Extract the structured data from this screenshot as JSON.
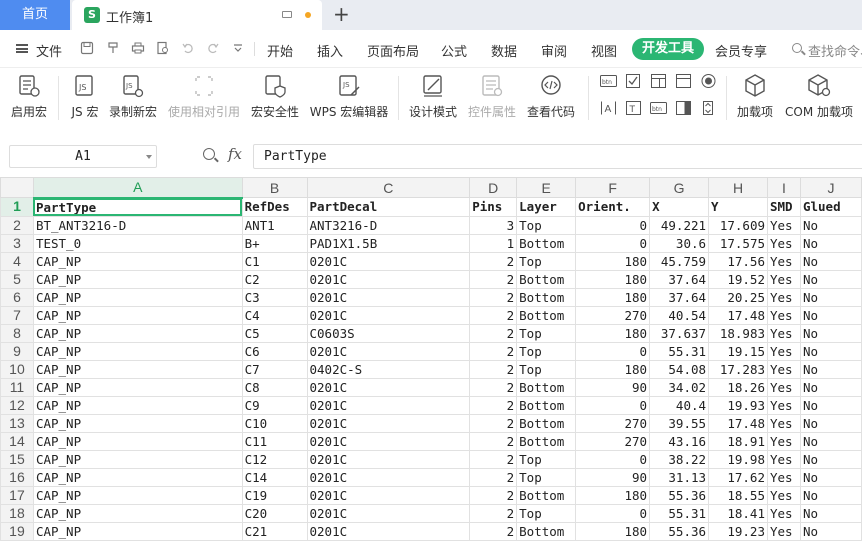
{
  "titlebar": {
    "home_label": "首页",
    "doc_name": "工作簿1",
    "doc_icon_letter": "S",
    "new_tab": "+"
  },
  "menu": {
    "file_label": "文件",
    "tabs": [
      "开始",
      "插入",
      "页面布局",
      "公式",
      "数据",
      "审阅",
      "视图",
      "开发工具",
      "会员专享"
    ],
    "active_tab": "开发工具",
    "search_placeholder": "查找命令、"
  },
  "ribbon": {
    "buttons": [
      {
        "label": "启用宏",
        "icon": "macro-enable-icon"
      },
      {
        "label": "JS 宏",
        "icon": "js-macro-icon"
      },
      {
        "label": "录制新宏",
        "icon": "record-macro-icon"
      },
      {
        "label": "使用相对引用",
        "icon": "relative-reference-icon"
      },
      {
        "label": "宏安全性",
        "icon": "macro-security-icon"
      },
      {
        "label": "WPS 宏编辑器",
        "icon": "macro-editor-icon"
      },
      {
        "label": "设计模式",
        "icon": "design-mode-icon"
      },
      {
        "label": "控件属性",
        "icon": "control-properties-icon"
      },
      {
        "label": "查看代码",
        "icon": "view-code-icon"
      },
      {
        "label": "加载项",
        "icon": "addins-icon"
      },
      {
        "label": "COM 加载项",
        "icon": "com-addins-icon"
      }
    ],
    "control_labels": [
      "btn",
      "btn"
    ]
  },
  "formula_bar": {
    "cell_ref": "A1",
    "fx_label": "fx",
    "value": "PartType"
  },
  "sheet": {
    "columns": [
      "A",
      "B",
      "C",
      "D",
      "E",
      "F",
      "G",
      "H",
      "I",
      "J"
    ],
    "rows": [
      {
        "n": "1",
        "cells": [
          "PartType",
          "RefDes",
          "PartDecal",
          "Pins",
          "Layer",
          "Orient.",
          "X",
          "Y",
          "SMD",
          "Glued"
        ]
      },
      {
        "n": "2",
        "cells": [
          "BT_ANT3216-D",
          "ANT1",
          "ANT3216-D",
          "3",
          "Top",
          "0",
          "49.221",
          "17.609",
          "Yes",
          "No"
        ]
      },
      {
        "n": "3",
        "cells": [
          "TEST_0",
          "B+",
          "PAD1X1.5B",
          "1",
          "Bottom",
          "0",
          "30.6",
          "17.575",
          "Yes",
          "No"
        ]
      },
      {
        "n": "4",
        "cells": [
          "CAP_NP",
          "C1",
          "0201C",
          "2",
          "Top",
          "180",
          "45.759",
          "17.56",
          "Yes",
          "No"
        ]
      },
      {
        "n": "5",
        "cells": [
          "CAP_NP",
          "C2",
          "0201C",
          "2",
          "Bottom",
          "180",
          "37.64",
          "19.52",
          "Yes",
          "No"
        ]
      },
      {
        "n": "6",
        "cells": [
          "CAP_NP",
          "C3",
          "0201C",
          "2",
          "Bottom",
          "180",
          "37.64",
          "20.25",
          "Yes",
          "No"
        ]
      },
      {
        "n": "7",
        "cells": [
          "CAP_NP",
          "C4",
          "0201C",
          "2",
          "Bottom",
          "270",
          "40.54",
          "17.48",
          "Yes",
          "No"
        ]
      },
      {
        "n": "8",
        "cells": [
          "CAP_NP",
          "C5",
          "C0603S",
          "2",
          "Top",
          "180",
          "37.637",
          "18.983",
          "Yes",
          "No"
        ]
      },
      {
        "n": "9",
        "cells": [
          "CAP_NP",
          "C6",
          "0201C",
          "2",
          "Top",
          "0",
          "55.31",
          "19.15",
          "Yes",
          "No"
        ]
      },
      {
        "n": "10",
        "cells": [
          "CAP_NP",
          "C7",
          "0402C-S",
          "2",
          "Top",
          "180",
          "54.08",
          "17.283",
          "Yes",
          "No"
        ]
      },
      {
        "n": "11",
        "cells": [
          "CAP_NP",
          "C8",
          "0201C",
          "2",
          "Bottom",
          "90",
          "34.02",
          "18.26",
          "Yes",
          "No"
        ]
      },
      {
        "n": "12",
        "cells": [
          "CAP_NP",
          "C9",
          "0201C",
          "2",
          "Bottom",
          "0",
          "40.4",
          "19.93",
          "Yes",
          "No"
        ]
      },
      {
        "n": "13",
        "cells": [
          "CAP_NP",
          "C10",
          "0201C",
          "2",
          "Bottom",
          "270",
          "39.55",
          "17.48",
          "Yes",
          "No"
        ]
      },
      {
        "n": "14",
        "cells": [
          "CAP_NP",
          "C11",
          "0201C",
          "2",
          "Bottom",
          "270",
          "43.16",
          "18.91",
          "Yes",
          "No"
        ]
      },
      {
        "n": "15",
        "cells": [
          "CAP_NP",
          "C12",
          "0201C",
          "2",
          "Top",
          "0",
          "38.22",
          "19.98",
          "Yes",
          "No"
        ]
      },
      {
        "n": "16",
        "cells": [
          "CAP_NP",
          "C14",
          "0201C",
          "2",
          "Top",
          "90",
          "31.13",
          "17.62",
          "Yes",
          "No"
        ]
      },
      {
        "n": "17",
        "cells": [
          "CAP_NP",
          "C19",
          "0201C",
          "2",
          "Bottom",
          "180",
          "55.36",
          "18.55",
          "Yes",
          "No"
        ]
      },
      {
        "n": "18",
        "cells": [
          "CAP_NP",
          "C20",
          "0201C",
          "2",
          "Top",
          "0",
          "55.31",
          "18.41",
          "Yes",
          "No"
        ]
      },
      {
        "n": "19",
        "cells": [
          "CAP_NP",
          "C21",
          "0201C",
          "2",
          "Bottom",
          "180",
          "55.36",
          "19.23",
          "Yes",
          "No"
        ]
      }
    ],
    "numeric_columns": [
      3,
      5,
      6,
      7
    ]
  },
  "colors": {
    "accent": "#2bb673",
    "home_tab": "#4f8cf0"
  }
}
